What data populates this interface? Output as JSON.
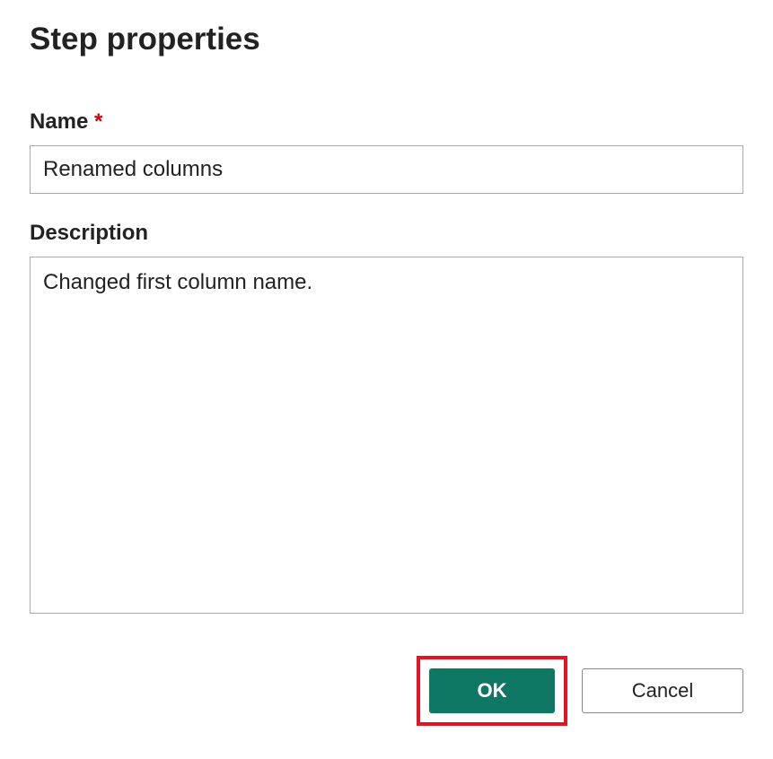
{
  "dialog": {
    "title": "Step properties"
  },
  "fields": {
    "name": {
      "label": "Name",
      "required_mark": "*",
      "value": "Renamed columns"
    },
    "description": {
      "label": "Description",
      "value": "Changed first column name."
    }
  },
  "buttons": {
    "ok": "OK",
    "cancel": "Cancel"
  },
  "colors": {
    "primary_button": "#0f7864",
    "highlight_border": "#e81123",
    "required_asterisk": "#c00"
  }
}
